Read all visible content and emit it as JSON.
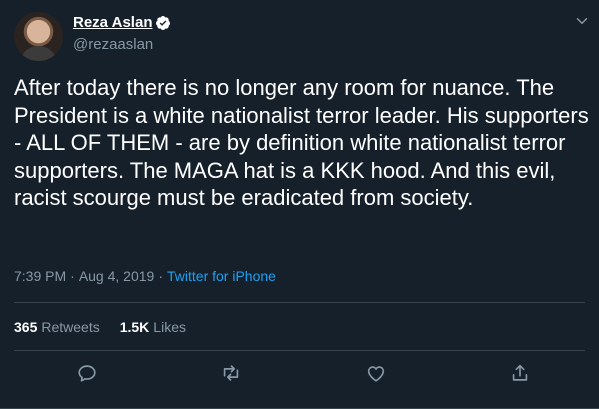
{
  "user": {
    "name": "Reza Aslan",
    "handle": "@rezaaslan"
  },
  "tweet": {
    "text": "After today there is no longer any room for nuance. The President is a white nationalist terror leader. His supporters - ALL OF THEM - are by definition white nationalist terror supporters. The MAGA hat is a KKK hood. And this evil, racist scourge must be eradicated from society.",
    "time": "7:39 PM",
    "separator": "·",
    "date": "Aug 4, 2019",
    "source": "Twitter for iPhone"
  },
  "stats": {
    "retweets_count": "365",
    "retweets_label": "Retweets",
    "likes_count": "1.5K",
    "likes_label": "Likes"
  },
  "colors": {
    "background": "#15202b",
    "secondary_text": "#8899a6",
    "link": "#1da1f2",
    "divider": "#38444d"
  },
  "icons": [
    "verified-badge-icon",
    "chevron-down-icon",
    "reply-icon",
    "retweet-icon",
    "like-icon",
    "share-icon"
  ]
}
